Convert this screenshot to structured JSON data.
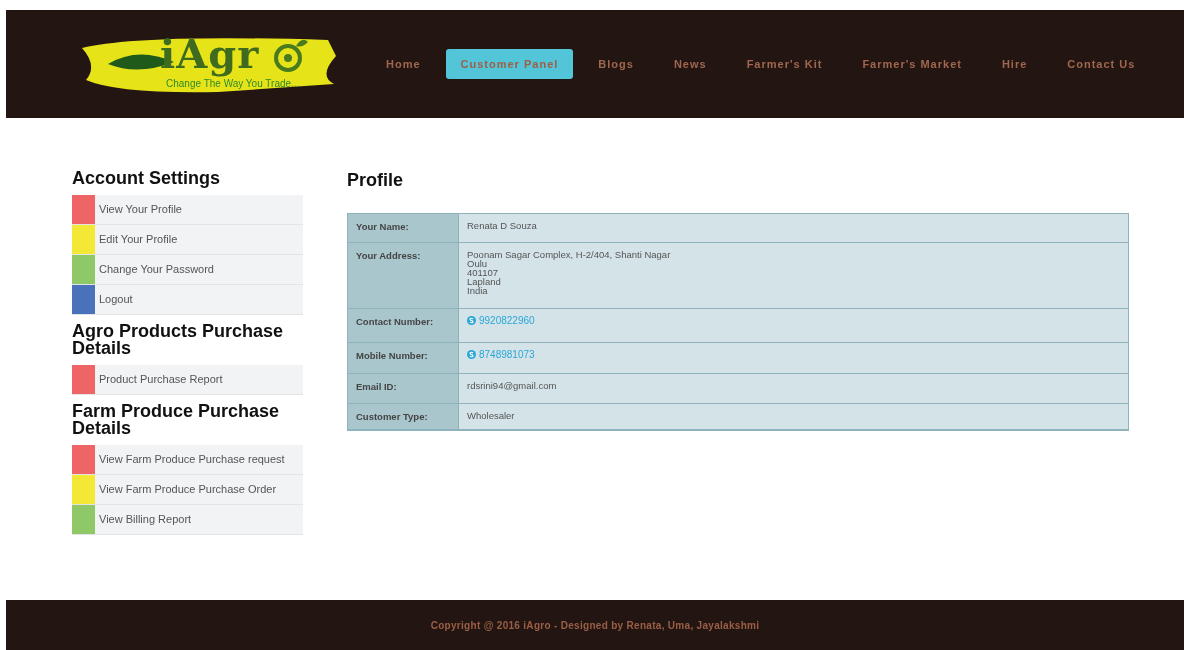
{
  "logo": {
    "name": "iAgr",
    "tagline": "Change The Way You Trade..."
  },
  "nav": [
    {
      "label": "Home",
      "selected": false
    },
    {
      "label": "Customer Panel",
      "selected": true
    },
    {
      "label": "Blogs",
      "selected": false
    },
    {
      "label": "News",
      "selected": false
    },
    {
      "label": "Farmer's Kit",
      "selected": false
    },
    {
      "label": "Farmer's Market",
      "selected": false
    },
    {
      "label": "Hire",
      "selected": false
    },
    {
      "label": "Contact Us",
      "selected": false
    }
  ],
  "sidebar": [
    {
      "title": "Account Settings",
      "items": [
        {
          "label": "View Your Profile",
          "color": "#ef6464"
        },
        {
          "label": "Edit Your Profile",
          "color": "#f2e835"
        },
        {
          "label": "Change Your Password",
          "color": "#8fc866"
        },
        {
          "label": "Logout",
          "color": "#4a72bb"
        }
      ]
    },
    {
      "title": "Agro Products Purchase Details",
      "items": [
        {
          "label": "Product Purchase Report",
          "color": "#ef6464"
        }
      ]
    },
    {
      "title": "Farm Produce Purchase Details",
      "items": [
        {
          "label": "View Farm Produce Purchase request",
          "color": "#ef6464"
        },
        {
          "label": "View Farm Produce Purchase Order",
          "color": "#f2e835"
        },
        {
          "label": "View Billing Report",
          "color": "#8fc866"
        }
      ]
    }
  ],
  "profile": {
    "title": "Profile",
    "rows": [
      {
        "label": "Your Name:",
        "kind": "text",
        "lines": [
          "Renata D Souza"
        ]
      },
      {
        "label": "Your Address:",
        "kind": "text",
        "lines": [
          "Poonam Sagar Complex, H-2/404, Shanti Nagar",
          "Oulu",
          "401107",
          "Lapland",
          "India"
        ]
      },
      {
        "label": "Contact Number:",
        "kind": "phone",
        "lines": [
          "9920822960"
        ]
      },
      {
        "label": "Mobile Number:",
        "kind": "phone",
        "lines": [
          "8748981073"
        ]
      },
      {
        "label": "Email ID:",
        "kind": "text",
        "lines": [
          "rdsrini94@gmail.com"
        ]
      },
      {
        "label": "Customer Type:",
        "kind": "text",
        "lines": [
          "Wholesaler"
        ]
      }
    ]
  },
  "footer": "Copyright @ 2016 iAgro - Designed by Renata, Uma, Jayalakshmi"
}
